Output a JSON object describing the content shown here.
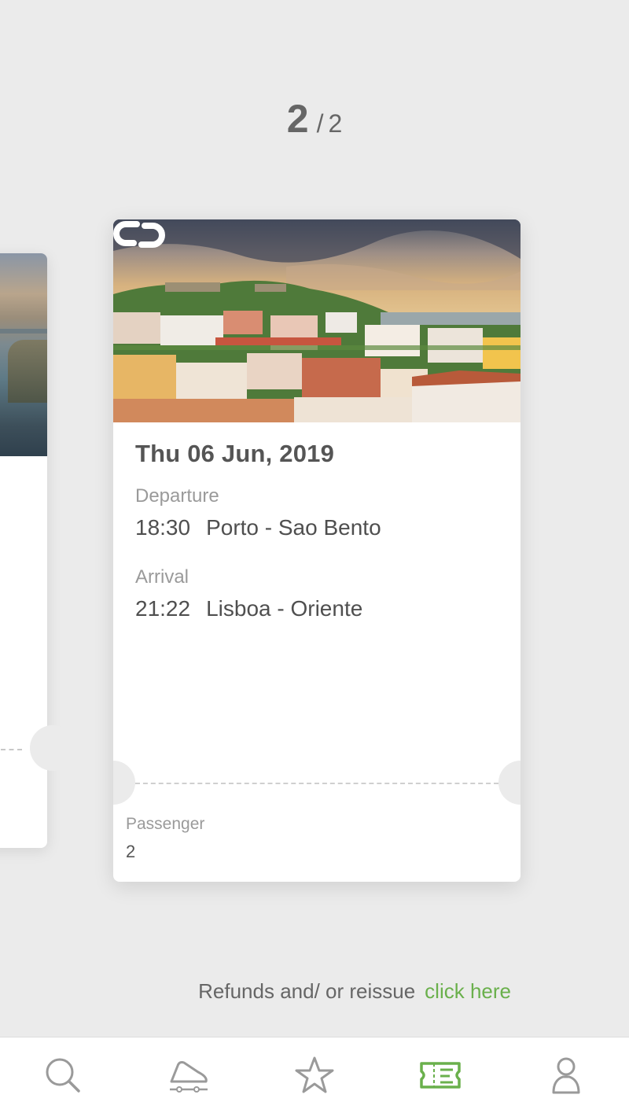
{
  "pager": {
    "current": "2",
    "separator": "/",
    "total": "2"
  },
  "ticket": {
    "date": "Thu 06 Jun,  2019",
    "departure": {
      "label": "Departure",
      "time": "18:30",
      "station": "Porto - Sao Bento"
    },
    "arrival": {
      "label": "Arrival",
      "time": "21:22",
      "station": "Lisboa - Oriente"
    },
    "passenger": {
      "label": "Passenger",
      "value": "2"
    }
  },
  "refunds": {
    "text": "Refunds and/ or reissue",
    "link": "click here"
  },
  "nav": {
    "items": [
      {
        "icon": "search-icon",
        "active": false
      },
      {
        "icon": "train-icon",
        "active": false
      },
      {
        "icon": "star-icon",
        "active": false
      },
      {
        "icon": "ticket-icon",
        "active": true
      },
      {
        "icon": "user-icon",
        "active": false
      }
    ]
  },
  "colors": {
    "accent": "#6ab04c",
    "background": "#ebebeb",
    "inactive_icon": "#9a9a9a"
  }
}
